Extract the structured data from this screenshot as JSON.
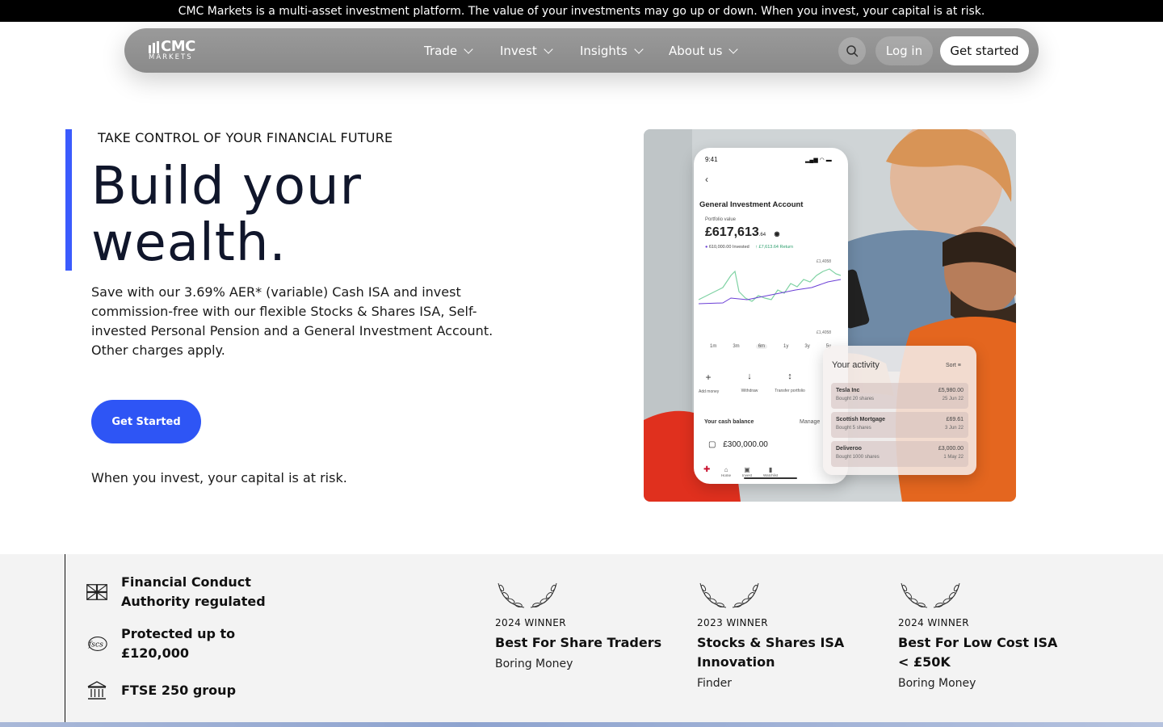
{
  "banner": {
    "text": "CMC Markets is a multi-asset investment platform. The value of your investments may go up or down. When you invest, your capital is at risk."
  },
  "nav": {
    "logo_main": "CMC",
    "logo_sub": "MARKETS",
    "items": [
      {
        "label": "Trade"
      },
      {
        "label": "Invest"
      },
      {
        "label": "Insights"
      },
      {
        "label": "About us"
      }
    ],
    "login_label": "Log in",
    "get_started_label": "Get started"
  },
  "hero": {
    "eyebrow": "TAKE CONTROL OF YOUR FINANCIAL FUTURE",
    "headline_line1": "Build your",
    "headline_line2": "wealth.",
    "paragraph": "Save with our 3.69% AER* (variable) Cash ISA and invest commission-free with our flexible Stocks & Shares ISA, Self-invested Personal Pension and a General Investment Account. Other charges apply.",
    "cta_label": "Get Started",
    "risk_text": "When you invest, your capital is at risk."
  },
  "phone": {
    "time": "9:41",
    "account_title": "General Investment Account",
    "portfolio_label": "Portfolio value",
    "portfolio_value": "£617,613",
    "portfolio_pence": ".64",
    "invested": "610,000.00 Invested",
    "return": "↑ £7,613.64 Return",
    "high": "£1,4058",
    "low": "£1,4058",
    "ranges": [
      "1m",
      "3m",
      "6m",
      "1y",
      "3y",
      "5y"
    ],
    "actions": [
      {
        "icon": "+",
        "label": "Add money"
      },
      {
        "icon": "↓",
        "label": "Withdraw"
      },
      {
        "icon": "↕",
        "label": "Transfer portfolio"
      }
    ],
    "cash_label": "Your cash balance",
    "manage_label": "Manage",
    "cash_value": "£300,000.00",
    "tabs": [
      "Home",
      "Invest",
      "Watchlist"
    ]
  },
  "activity": {
    "title": "Your activity",
    "sort_label": "Sort",
    "rows": [
      {
        "name": "Tesla Inc",
        "sub": "Bought 20 shares",
        "amount": "£5,980.00",
        "date": "25 Jun 22"
      },
      {
        "name": "Scottish Mortgage",
        "sub": "Bought 5 shares",
        "amount": "£69.61",
        "date": "3 Jun 22"
      },
      {
        "name": "Deliveroo",
        "sub": "Bought 1000 shares",
        "amount": "£3,000.00",
        "date": "1 May 22"
      }
    ]
  },
  "trust": [
    {
      "icon": "uk-flag-icon",
      "text": "Financial Conduct Authority regulated"
    },
    {
      "icon": "fscs-icon",
      "text": "Protected up to £120,000"
    },
    {
      "icon": "bank-building-icon",
      "text": "FTSE 250 group"
    }
  ],
  "awards": [
    {
      "year": "2024 WINNER",
      "title": "Best For Share Traders",
      "source": "Boring Money"
    },
    {
      "year": "2023 WINNER",
      "title": "Stocks & Shares ISA Innovation",
      "source": "Finder"
    },
    {
      "year": "2024 WINNER",
      "title": "Best For Low Cost ISA < £50K",
      "source": "Boring Money"
    }
  ],
  "colors": {
    "accent": "#3b5bfd",
    "cta": "#2e55f5",
    "banner": "#000000"
  }
}
